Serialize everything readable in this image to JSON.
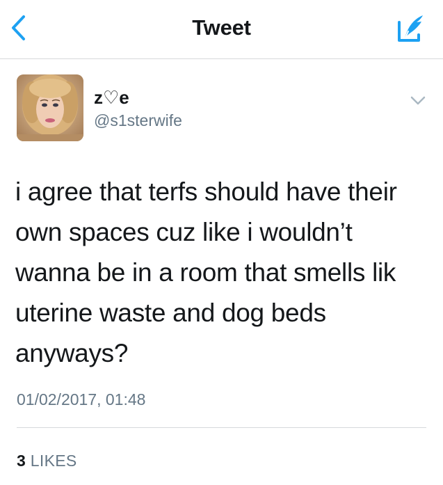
{
  "nav": {
    "title": "Tweet",
    "back_icon": "chevron-left-icon",
    "compose_icon": "compose-tweet-icon",
    "accent_color": "#1da1f2"
  },
  "tweet": {
    "author": {
      "display_name": "z♡e",
      "handle": "@s1sterwife",
      "avatar": "profile-photo"
    },
    "menu_icon": "chevron-down-icon",
    "text": "i agree that terfs should have their\nown spaces cuz like i wouldn’t\nwanna be in a room that smells lik\nuterine waste and dog beds\nanyways?",
    "timestamp": "01/02/2017, 01:48",
    "stats": {
      "likes_count": "3",
      "likes_label": "LIKES"
    }
  }
}
